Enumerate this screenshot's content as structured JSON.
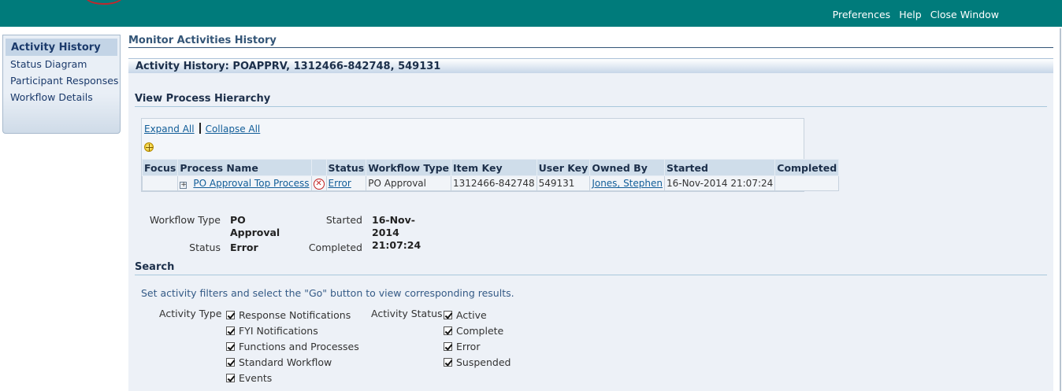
{
  "header": {
    "links": [
      "Preferences",
      "Help",
      "Close Window"
    ],
    "brand_color": "#007b7b"
  },
  "sidebar": {
    "active": "Activity History",
    "items": [
      "Status Diagram",
      "Participant Responses",
      "Workflow Details"
    ]
  },
  "page": {
    "title": "Monitor Activities History",
    "section_header": "Activity History: POAPPRV, 1312466-842748, 549131"
  },
  "hierarchy": {
    "title": "View Process Hierarchy",
    "expand_all": "Expand All",
    "collapse_all": "Collapse All",
    "columns": [
      "Focus",
      "Process Name",
      "",
      "Status",
      "Workflow Type",
      "Item Key",
      "User Key",
      "Owned By",
      "Started",
      "Completed"
    ],
    "rows": [
      {
        "focus": "",
        "process_name": "PO Approval Top Process",
        "status": "Error",
        "workflow_type": "PO Approval",
        "item_key": "1312466-842748",
        "user_key": "549131",
        "owned_by": "Jones, Stephen",
        "started": "16-Nov-2014 21:07:24",
        "completed": ""
      }
    ]
  },
  "details": {
    "workflow_type_label": "Workflow Type",
    "workflow_type_line1": "PO",
    "workflow_type_line2": "Approval",
    "status_label": "Status",
    "status_value": "Error",
    "started_label": "Started",
    "started_line1": "16-Nov-2014",
    "started_line2": "21:07:24",
    "completed_label": "Completed"
  },
  "search": {
    "title": "Search",
    "description": "Set activity filters and select the \"Go\" button to view corresponding results.",
    "activity_type_label": "Activity Type",
    "activity_types": [
      "Response Notifications",
      "FYI Notifications",
      "Functions and Processes",
      "Standard Workflow",
      "Events"
    ],
    "activity_status_label": "Activity Status",
    "activity_statuses": [
      "Active",
      "Complete",
      "Error",
      "Suspended"
    ]
  }
}
